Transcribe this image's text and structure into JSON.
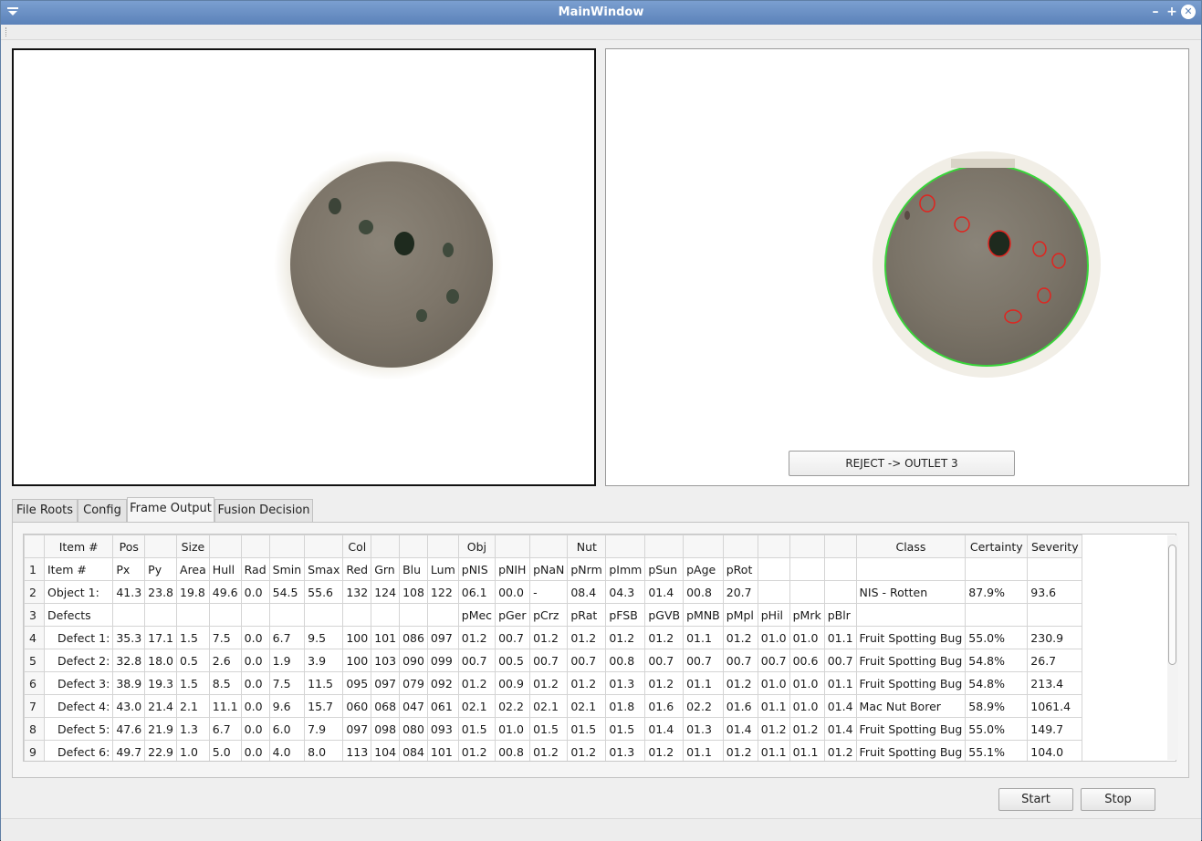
{
  "window": {
    "title": "MainWindow",
    "minimize_glyph": "–",
    "maximize_glyph": "+",
    "close_glyph": "✕"
  },
  "output": {
    "decision_label": "REJECT -> OUTLET 3"
  },
  "tabs": [
    {
      "label": "File Roots"
    },
    {
      "label": "Config"
    },
    {
      "label": "Frame Output"
    },
    {
      "label": "Fusion Decision"
    }
  ],
  "active_tab": "Frame Output",
  "table": {
    "headers": [
      "",
      "Item #",
      "Pos",
      "",
      "Size",
      "",
      "",
      "",
      "",
      "Col",
      "",
      "",
      "",
      "Obj",
      "",
      "",
      "Nut",
      "",
      "",
      "",
      "",
      "",
      "",
      "",
      "Class",
      "Certainty",
      "Severity"
    ],
    "rows": [
      [
        "1",
        "Item #",
        "Px",
        "Py",
        "Area",
        "Hull",
        "Rad",
        "Smin",
        "Smax",
        "Red",
        "Grn",
        "Blu",
        "Lum",
        "pNIS",
        "pNIH",
        "pNaN",
        "pNrm",
        "pImm",
        "pSun",
        "pAge",
        "pRot",
        "",
        "",
        "",
        "",
        "",
        ""
      ],
      [
        "2",
        "Object 1:",
        "41.3",
        "23.8",
        "19.8",
        "49.6",
        "0.0",
        "54.5",
        "55.6",
        "132",
        "124",
        "108",
        "122",
        "06.1",
        "00.0",
        "-",
        "08.4",
        "04.3",
        "01.4",
        "00.8",
        "20.7",
        "",
        "",
        "",
        "NIS - Rotten",
        "87.9%",
        "93.6"
      ],
      [
        "3",
        "Defects",
        "",
        "",
        "",
        "",
        "",
        "",
        "",
        "",
        "",
        "",
        "",
        "pMec",
        "pGer",
        "pCrz",
        "pRat",
        "pFSB",
        "pGVB",
        "pMNB",
        "pMpl",
        "pHil",
        "pMrk",
        "pBlr",
        "",
        "",
        ""
      ],
      [
        "4",
        "  Defect 1:",
        "35.3",
        "17.1",
        "1.5",
        "7.5",
        "0.0",
        "6.7",
        "9.5",
        "100",
        "101",
        "086",
        "097",
        "01.2",
        "00.7",
        "01.2",
        "01.2",
        "01.2",
        "01.2",
        "01.1",
        "01.2",
        "01.0",
        "01.0",
        "01.1",
        "Fruit Spotting Bug",
        "55.0%",
        "230.9"
      ],
      [
        "5",
        "  Defect 2:",
        "32.8",
        "18.0",
        "0.5",
        "2.6",
        "0.0",
        "1.9",
        "3.9",
        "100",
        "103",
        "090",
        "099",
        "00.7",
        "00.5",
        "00.7",
        "00.7",
        "00.8",
        "00.7",
        "00.7",
        "00.7",
        "00.7",
        "00.6",
        "00.7",
        "Fruit Spotting Bug",
        "54.8%",
        "26.7"
      ],
      [
        "6",
        "  Defect 3:",
        "38.9",
        "19.3",
        "1.5",
        "8.5",
        "0.0",
        "7.5",
        "11.5",
        "095",
        "097",
        "079",
        "092",
        "01.2",
        "00.9",
        "01.2",
        "01.2",
        "01.3",
        "01.2",
        "01.1",
        "01.2",
        "01.0",
        "01.0",
        "01.1",
        "Fruit Spotting Bug",
        "54.8%",
        "213.4"
      ],
      [
        "7",
        "  Defect 4:",
        "43.0",
        "21.4",
        "2.1",
        "11.1",
        "0.0",
        "9.6",
        "15.7",
        "060",
        "068",
        "047",
        "061",
        "02.1",
        "02.2",
        "02.1",
        "02.1",
        "01.8",
        "01.6",
        "02.2",
        "01.6",
        "01.1",
        "01.0",
        "01.4",
        "Mac Nut Borer",
        "58.9%",
        "1061.4"
      ],
      [
        "8",
        "  Defect 5:",
        "47.6",
        "21.9",
        "1.3",
        "6.7",
        "0.0",
        "6.0",
        "7.9",
        "097",
        "098",
        "080",
        "093",
        "01.5",
        "01.0",
        "01.5",
        "01.5",
        "01.5",
        "01.4",
        "01.3",
        "01.4",
        "01.2",
        "01.2",
        "01.4",
        "Fruit Spotting Bug",
        "55.0%",
        "149.7"
      ],
      [
        "9",
        "  Defect 6:",
        "49.7",
        "22.9",
        "1.0",
        "5.0",
        "0.0",
        "4.0",
        "8.0",
        "113",
        "104",
        "084",
        "101",
        "01.2",
        "00.8",
        "01.2",
        "01.2",
        "01.3",
        "01.2",
        "01.1",
        "01.2",
        "01.1",
        "01.1",
        "01.2",
        "Fruit Spotting Bug",
        "55.1%",
        "104.0"
      ]
    ]
  },
  "buttons": {
    "start": "Start",
    "stop": "Stop"
  },
  "colors": {
    "contour": "#39d43a",
    "defect_outline": "#e0241f",
    "titlebar": "#6a8fc4"
  },
  "icons": [
    "window-menu-icon",
    "minimize-icon",
    "maximize-icon",
    "close-icon"
  ]
}
